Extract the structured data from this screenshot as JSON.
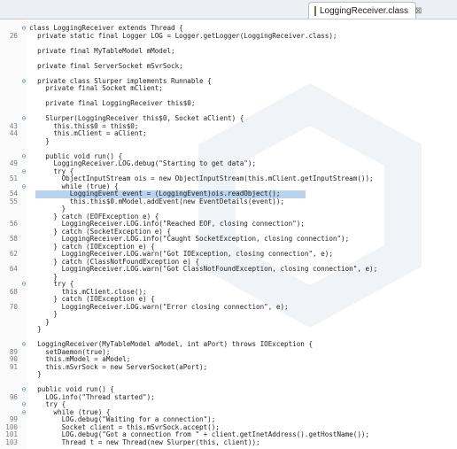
{
  "tab": {
    "title": "LoggingReceiver.class",
    "close": "⊠"
  },
  "lines": [
    {
      "n": "",
      "fold": "⊖",
      "code": "class LoggingReceiver extends Thread {"
    },
    {
      "n": "26",
      "fold": "",
      "code": "  private static final Logger LOG = Logger.getLogger(LoggingReceiver.class);"
    },
    {
      "n": "",
      "fold": "",
      "code": ""
    },
    {
      "n": "",
      "fold": "",
      "code": "  private final MyTableModel mModel;"
    },
    {
      "n": "",
      "fold": "",
      "code": ""
    },
    {
      "n": "",
      "fold": "",
      "code": "  private final ServerSocket mSvrSock;"
    },
    {
      "n": "",
      "fold": "",
      "code": ""
    },
    {
      "n": "",
      "fold": "⊖",
      "code": "  private class Slurper implements Runnable {"
    },
    {
      "n": "",
      "fold": "",
      "code": "    private final Socket mClient;"
    },
    {
      "n": "",
      "fold": "",
      "code": ""
    },
    {
      "n": "",
      "fold": "",
      "code": "    private final LoggingReceiver this$0;"
    },
    {
      "n": "",
      "fold": "",
      "code": ""
    },
    {
      "n": "",
      "fold": "⊖",
      "code": "    Slurper(LoggingReceiver this$0, Socket aClient) {"
    },
    {
      "n": "43",
      "fold": "",
      "code": "      this.this$0 = this$0;"
    },
    {
      "n": "44",
      "fold": "",
      "code": "      this.mClient = aClient;"
    },
    {
      "n": "",
      "fold": "",
      "code": "    }"
    },
    {
      "n": "",
      "fold": "",
      "code": ""
    },
    {
      "n": "",
      "fold": "⊖",
      "code": "    public void run() {"
    },
    {
      "n": "49",
      "fold": "",
      "code": "      LoggingReceiver.LOG.debug(\"Starting to get data\");"
    },
    {
      "n": "",
      "fold": "⊖",
      "code": "      try {"
    },
    {
      "n": "51",
      "fold": "",
      "code": "        ObjectInputStream ois = new ObjectInputStream(this.mClient.getInputStream());"
    },
    {
      "n": "",
      "fold": "⊖",
      "code": "        while (true) {"
    },
    {
      "n": "54",
      "fold": "",
      "code": "          LoggingEvent event = (LoggingEvent)ois.readObject();",
      "hl": true
    },
    {
      "n": "55",
      "fold": "",
      "code": "          this.this$0.mModel.addEvent(new EventDetails(event));"
    },
    {
      "n": "",
      "fold": "",
      "code": "        }"
    },
    {
      "n": "",
      "fold": "",
      "code": "      } catch (EOFException e) {"
    },
    {
      "n": "56",
      "fold": "",
      "code": "        LoggingReceiver.LOG.info(\"Reached EOF, closing connection\");"
    },
    {
      "n": "",
      "fold": "",
      "code": "      } catch (SocketException e) {"
    },
    {
      "n": "58",
      "fold": "",
      "code": "        LoggingReceiver.LOG.info(\"Caught SocketException, closing connection\");"
    },
    {
      "n": "",
      "fold": "",
      "code": "      } catch (IOException e) {"
    },
    {
      "n": "62",
      "fold": "",
      "code": "        LoggingReceiver.LOG.warn(\"Got IOException, closing connection\", e);"
    },
    {
      "n": "",
      "fold": "",
      "code": "      } catch (ClassNotFoundException e) {"
    },
    {
      "n": "64",
      "fold": "",
      "code": "        LoggingReceiver.LOG.warn(\"Got ClassNotFoundException, closing connection\", e);"
    },
    {
      "n": "",
      "fold": "",
      "code": "      }"
    },
    {
      "n": "",
      "fold": "⊖",
      "code": "      try {"
    },
    {
      "n": "68",
      "fold": "",
      "code": "        this.mClient.close();"
    },
    {
      "n": "",
      "fold": "",
      "code": "      } catch (IOException e) {"
    },
    {
      "n": "70",
      "fold": "",
      "code": "        LoggingReceiver.LOG.warn(\"Error closing connection\", e);"
    },
    {
      "n": "",
      "fold": "",
      "code": "      }"
    },
    {
      "n": "",
      "fold": "",
      "code": "    }"
    },
    {
      "n": "",
      "fold": "",
      "code": "  }"
    },
    {
      "n": "",
      "fold": "",
      "code": ""
    },
    {
      "n": "",
      "fold": "⊖",
      "code": "  LoggingReceiver(MyTableModel aModel, int aPort) throws IOException {"
    },
    {
      "n": "89",
      "fold": "",
      "code": "    setDaemon(true);"
    },
    {
      "n": "90",
      "fold": "",
      "code": "    this.mModel = aModel;"
    },
    {
      "n": "91",
      "fold": "",
      "code": "    this.mSvrSock = new ServerSocket(aPort);"
    },
    {
      "n": "",
      "fold": "",
      "code": "  }"
    },
    {
      "n": "",
      "fold": "",
      "code": ""
    },
    {
      "n": "",
      "fold": "⊖",
      "code": "  public void run() {"
    },
    {
      "n": "96",
      "fold": "",
      "code": "    LOG.info(\"Thread started\");"
    },
    {
      "n": "",
      "fold": "⊖",
      "code": "    try {"
    },
    {
      "n": "",
      "fold": "⊖",
      "code": "      while (true) {"
    },
    {
      "n": "99",
      "fold": "",
      "code": "        LOG.debug(\"Waiting for a connection\");"
    },
    {
      "n": "100",
      "fold": "",
      "code": "        Socket client = this.mSvrSock.accept();"
    },
    {
      "n": "101",
      "fold": "",
      "code": "        LOG.debug(\"Got a connection from \" + client.getInetAddress().getHostName());"
    },
    {
      "n": "103",
      "fold": "",
      "code": "        Thread t = new Thread(new Slurper(this, client));"
    }
  ]
}
